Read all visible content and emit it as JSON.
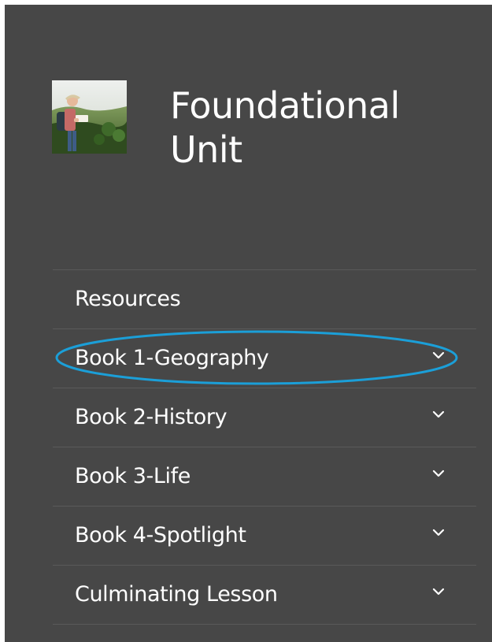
{
  "header": {
    "title_line1": "Foundational",
    "title_line2": "Unit",
    "thumbnail_icon": "hiker-reading-map-photo"
  },
  "nav": {
    "items": [
      {
        "label": "Resources",
        "expandable": false
      },
      {
        "label": "Book 1-Geography",
        "expandable": true,
        "highlighted": true
      },
      {
        "label": "Book 2-History",
        "expandable": true
      },
      {
        "label": "Book 3-Life",
        "expandable": true
      },
      {
        "label": "Book 4-Spotlight",
        "expandable": true
      },
      {
        "label": "Culminating Lesson",
        "expandable": true
      }
    ],
    "chevron_icon": "chevron-down-icon"
  },
  "colors": {
    "panel_background": "#474747",
    "divider": "#5a5a5a",
    "text": "#ffffff",
    "highlight_ring": "#1b9fd8"
  }
}
